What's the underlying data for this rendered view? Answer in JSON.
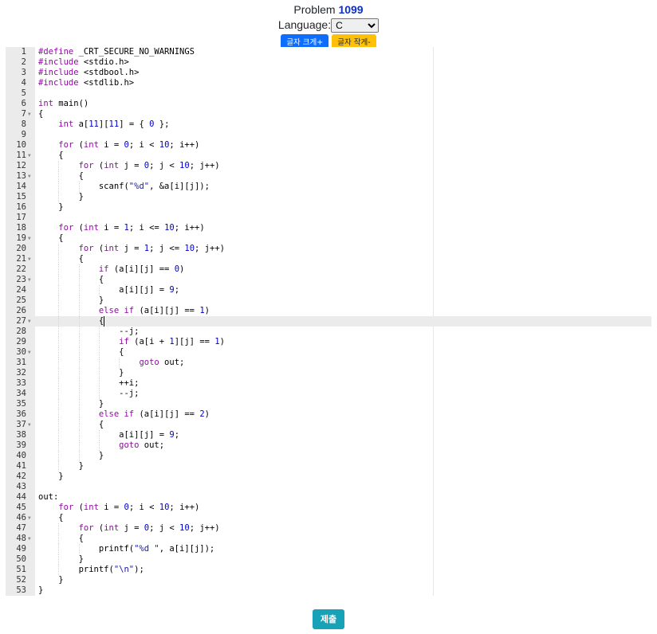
{
  "header": {
    "problem_label": "Problem",
    "problem_id": "1099",
    "language_label": "Language:",
    "language_value": "C"
  },
  "buttons": {
    "font_bigger": "글자 크게+",
    "font_smaller": "글자 작게-",
    "submit": "제출"
  },
  "editor": {
    "active_line": 27,
    "fold_lines": [
      7,
      11,
      13,
      19,
      21,
      23,
      27,
      30,
      37,
      46,
      48
    ],
    "lines": [
      "#define _CRT_SECURE_NO_WARNINGS",
      "#include <stdio.h>",
      "#include <stdbool.h>",
      "#include <stdlib.h>",
      "",
      "int main()",
      "{",
      "    int a[11][11] = { 0 };",
      "",
      "    for (int i = 0; i < 10; i++)",
      "    {",
      "        for (int j = 0; j < 10; j++)",
      "        {",
      "            scanf(\"%d\", &a[i][j]);",
      "        }",
      "    }",
      "",
      "    for (int i = 1; i <= 10; i++)",
      "    {",
      "        for (int j = 1; j <= 10; j++)",
      "        {",
      "            if (a[i][j] == 0)",
      "            {",
      "                a[i][j] = 9;",
      "            }",
      "            else if (a[i][j] == 1)",
      "            {",
      "                --j;",
      "                if (a[i + 1][j] == 1)",
      "                {",
      "                    goto out;",
      "                }",
      "                ++i;",
      "                --j;",
      "            }",
      "            else if (a[i][j] == 2)",
      "            {",
      "                a[i][j] = 9;",
      "                goto out;",
      "            }",
      "        }",
      "    }",
      "",
      "out:",
      "    for (int i = 0; i < 10; i++)",
      "    {",
      "        for (int j = 0; j < 10; j++)",
      "        {",
      "            printf(\"%d \", a[i][j]);",
      "        }",
      "        printf(\"\\n\");",
      "    }",
      "}"
    ]
  }
}
